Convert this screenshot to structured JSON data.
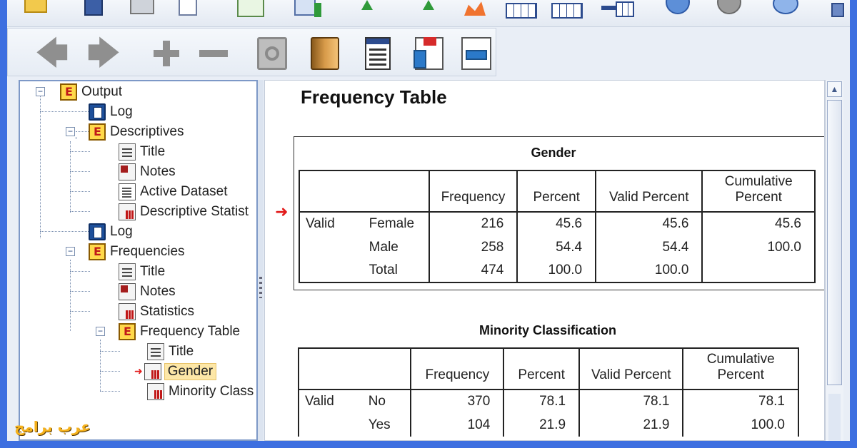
{
  "toolbar_top": {
    "icons": [
      "open-icon",
      "save-icon",
      "print-icon",
      "preview-icon",
      "export-icon",
      "import-icon",
      "goto-case-icon",
      "goto-variable-icon",
      "chart-builder-icon",
      "data-editor-icon",
      "pivot-table-icon",
      "split-icon",
      "circle-icon",
      "grey-circle-icon",
      "bubble-icon",
      "info-icon"
    ]
  },
  "toolbar_outline": {
    "buttons": [
      "back-icon",
      "forward-icon",
      "expand-icon",
      "collapse-icon",
      "show-icon",
      "hide-icon",
      "insert-heading-icon",
      "insert-title-icon",
      "insert-text-icon",
      "promote-icon"
    ]
  },
  "outline": {
    "items": [
      {
        "label": "Output"
      },
      {
        "label": "Log"
      },
      {
        "label": "Descriptives"
      },
      {
        "label": "Title"
      },
      {
        "label": "Notes"
      },
      {
        "label": "Active Dataset"
      },
      {
        "label": "Descriptive Statist"
      },
      {
        "label": "Log"
      },
      {
        "label": "Frequencies"
      },
      {
        "label": "Title"
      },
      {
        "label": "Notes"
      },
      {
        "label": "Statistics"
      },
      {
        "label": "Frequency Table"
      },
      {
        "label": "Title"
      },
      {
        "label": "Gender"
      },
      {
        "label": "Minority Class"
      }
    ]
  },
  "content": {
    "heading": "Frequency Table",
    "table1": {
      "title": "Gender",
      "headers": [
        "Frequency",
        "Percent",
        "Valid Percent",
        "Cumulative",
        "Percent"
      ],
      "group": "Valid",
      "rows": [
        {
          "label": "Female",
          "frequency": "216",
          "percent": "45.6",
          "valid": "45.6",
          "cumulative": "45.6"
        },
        {
          "label": "Male",
          "frequency": "258",
          "percent": "54.4",
          "valid": "54.4",
          "cumulative": "100.0"
        },
        {
          "label": "Total",
          "frequency": "474",
          "percent": "100.0",
          "valid": "100.0",
          "cumulative": ""
        }
      ]
    },
    "table2": {
      "title": "Minority Classification",
      "headers": [
        "Frequency",
        "Percent",
        "Valid Percent",
        "Cumulative",
        "Percent"
      ],
      "group": "Valid",
      "rows": [
        {
          "label": "No",
          "frequency": "370",
          "percent": "78.1",
          "valid": "78.1",
          "cumulative": "78.1"
        },
        {
          "label": "Yes",
          "frequency": "104",
          "percent": "21.9",
          "valid": "21.9",
          "cumulative": "100.0"
        }
      ]
    }
  },
  "watermark": "عرب برامج",
  "colors": {
    "frame": "#3d6fe0",
    "selection": "#fde7a7",
    "marker": "#e21b1b"
  }
}
